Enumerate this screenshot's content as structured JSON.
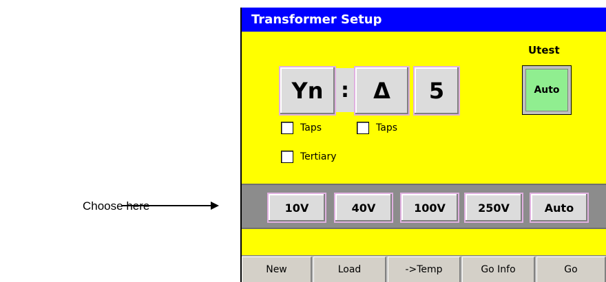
{
  "annotation": {
    "label": "Choose here"
  },
  "window": {
    "title": "Transformer Setup"
  },
  "winding": {
    "primary": "Yn",
    "separator": ":",
    "secondary": "Δ",
    "phase_shift": "5"
  },
  "utest": {
    "label": "Utest",
    "button": "Auto"
  },
  "checkboxes": {
    "primary_taps": "Taps",
    "secondary_taps": "Taps",
    "tertiary": "Tertiary"
  },
  "voltages": [
    "10V",
    "40V",
    "100V",
    "250V",
    "Auto"
  ],
  "toolbar": [
    "New",
    "Load",
    "->Temp",
    "Go Info",
    "Go"
  ],
  "colors": {
    "title_bg": "#0000ff",
    "panel_bg": "#ffff00",
    "selected": "#90ee90"
  }
}
